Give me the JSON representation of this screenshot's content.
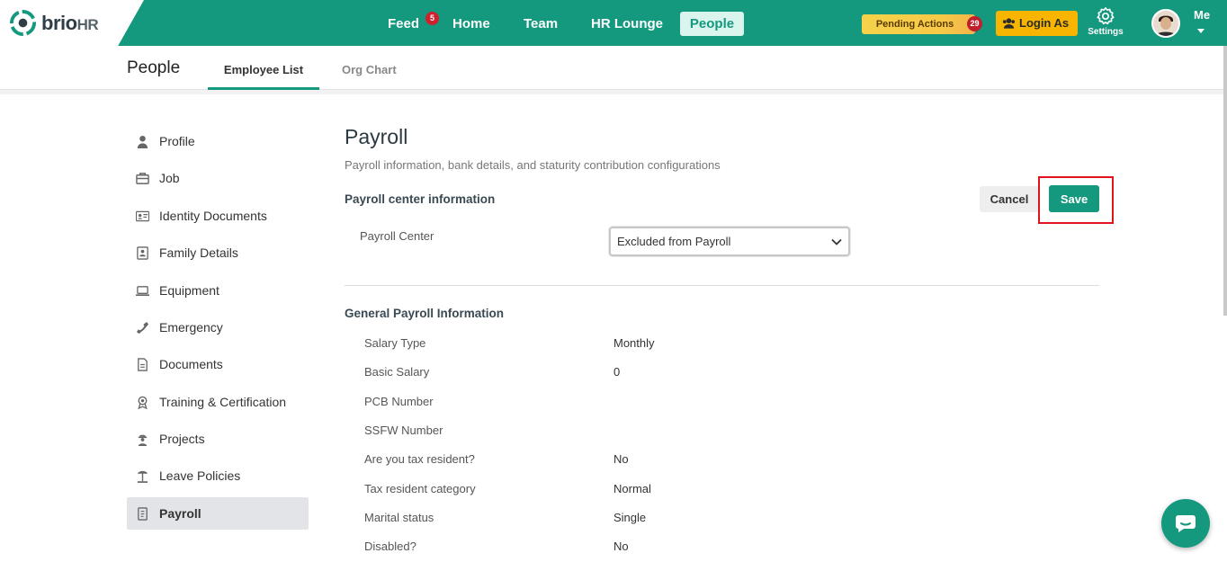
{
  "brand": {
    "name": "brio",
    "suffix": "HR"
  },
  "nav": {
    "feed": "Feed",
    "feed_badge": "5",
    "home": "Home",
    "team": "Team",
    "hr_lounge": "HR Lounge",
    "people": "People"
  },
  "actions": {
    "pending_label": "Pending Actions",
    "pending_count": "29",
    "login_as": "Login As",
    "settings": "Settings",
    "me": "Me"
  },
  "subheader": {
    "title": "People",
    "tabs": [
      {
        "label": "Employee List",
        "active": true
      },
      {
        "label": "Org Chart",
        "active": false
      }
    ]
  },
  "sidebar": {
    "items": [
      {
        "label": "Profile",
        "icon": "user-icon"
      },
      {
        "label": "Job",
        "icon": "briefcase-icon"
      },
      {
        "label": "Identity Documents",
        "icon": "id-card-icon"
      },
      {
        "label": "Family Details",
        "icon": "contact-book-icon"
      },
      {
        "label": "Equipment",
        "icon": "laptop-icon"
      },
      {
        "label": "Emergency",
        "icon": "phone-icon"
      },
      {
        "label": "Documents",
        "icon": "document-icon"
      },
      {
        "label": "Training & Certification",
        "icon": "award-icon"
      },
      {
        "label": "Projects",
        "icon": "worker-icon"
      },
      {
        "label": "Leave Policies",
        "icon": "beach-icon"
      },
      {
        "label": "Payroll",
        "icon": "receipt-icon",
        "active": true
      }
    ]
  },
  "page": {
    "title": "Payroll",
    "description": "Payroll information, bank details, and staturity contribution configurations",
    "section1": "Payroll center information",
    "cancel": "Cancel",
    "save": "Save",
    "payroll_center_label": "Payroll Center",
    "payroll_center_value": "Excluded from Payroll",
    "section2": "General Payroll Information",
    "rows": [
      {
        "label": "Salary Type",
        "value": "Monthly"
      },
      {
        "label": "Basic Salary",
        "value": "0"
      },
      {
        "label": "PCB Number",
        "value": ""
      },
      {
        "label": "SSFW Number",
        "value": ""
      },
      {
        "label": "Are you tax resident?",
        "value": "No"
      },
      {
        "label": "Tax resident category",
        "value": "Normal"
      },
      {
        "label": "Marital status",
        "value": "Single"
      },
      {
        "label": "Disabled?",
        "value": "No"
      }
    ]
  },
  "colors": {
    "primary": "#14997e",
    "highlight": "#e0121b",
    "badge": "#d0202e",
    "login_as": "#f7b500"
  }
}
